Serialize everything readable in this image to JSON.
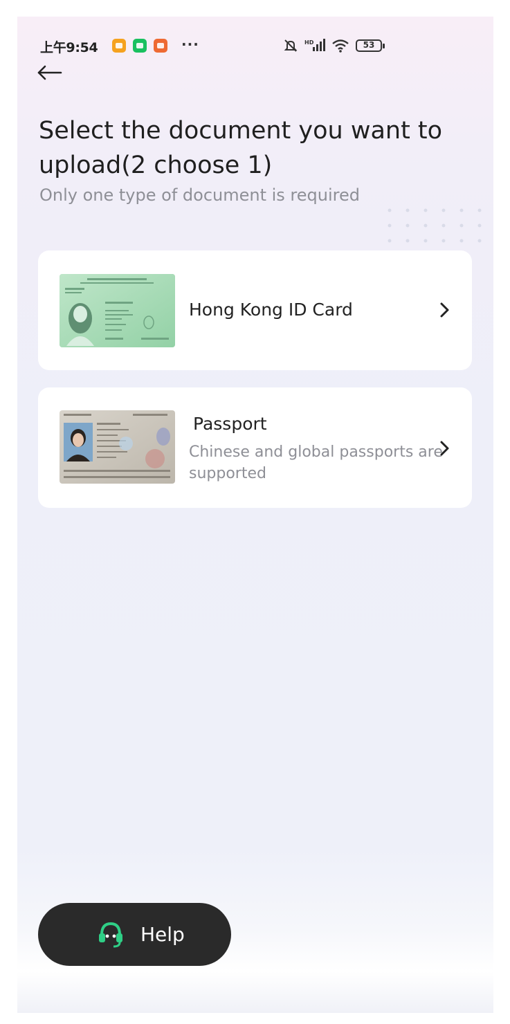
{
  "status_bar": {
    "time": "上午9:54",
    "more": "···",
    "battery": "53"
  },
  "header": {
    "title": "Select the document you want to upload(2 choose 1)",
    "subtitle": "Only one type of document is required"
  },
  "documents": [
    {
      "title": "Hong Kong ID Card",
      "description": ""
    },
    {
      "title": "Passport",
      "description": "Chinese and global passports are supported"
    }
  ],
  "help": {
    "label": "Help"
  },
  "colors": {
    "help_bg": "#2a2a2a",
    "help_icon": "#2fcf86",
    "hkid_card": "#a8dcb7",
    "passport_card": "#c9c4bb"
  },
  "icons": {
    "back": "back-arrow-icon",
    "chevron": "chevron-right-icon",
    "help": "headset-icon"
  }
}
